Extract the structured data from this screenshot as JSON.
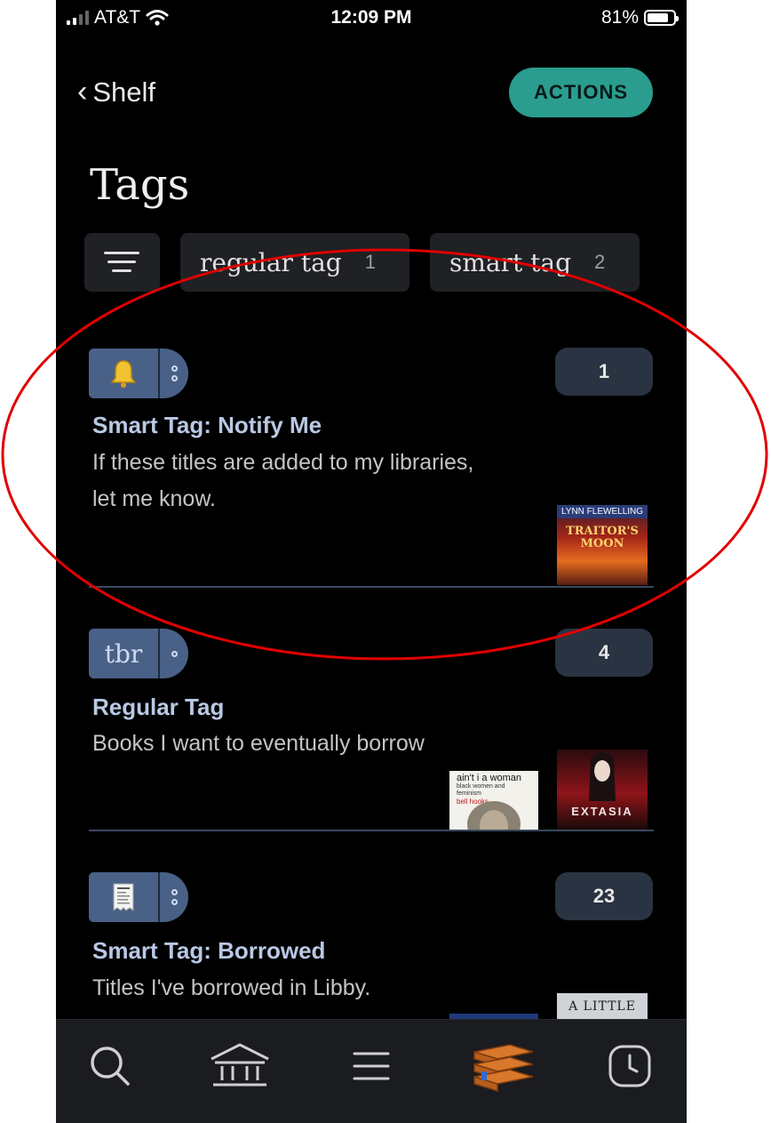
{
  "status_bar": {
    "carrier": "AT&T",
    "time": "12:09 PM",
    "battery_percent": "81%",
    "battery_level": 0.81
  },
  "nav": {
    "back_label": "Shelf",
    "actions_label": "ACTIONS"
  },
  "page_title": "Tags",
  "filters": [
    {
      "label": "regular tag",
      "count": "1"
    },
    {
      "label": "smart tag",
      "count": "2"
    }
  ],
  "tags": [
    {
      "badge_icon": "bell-icon",
      "badge_text": "",
      "title": "Smart Tag: Notify Me",
      "description": "If these titles are added to my libraries, let me know.",
      "count": "1",
      "covers": [
        {
          "name": "book-cover-traitors-moon",
          "author": "LYNN FLEWELLING",
          "title": "TRAITOR'S MOON"
        }
      ]
    },
    {
      "badge_icon": "",
      "badge_text": "tbr",
      "title": "Regular Tag",
      "description": "Books I want to eventually borrow",
      "count": "4",
      "covers": [
        {
          "name": "book-cover-aint-i-a-woman",
          "title": "ain't i a woman",
          "subtitle": "black women and feminism",
          "author": "bell hooks"
        },
        {
          "name": "book-cover-extasia",
          "title": "EXTASIA"
        }
      ]
    },
    {
      "badge_icon": "receipt-icon",
      "badge_text": "",
      "title": "Smart Tag: Borrowed",
      "description": "Titles I've borrowed in Libby.",
      "count": "23",
      "covers": [
        {
          "name": "book-cover-a-little-life",
          "title": "A LITTLE"
        }
      ]
    }
  ],
  "tabbar": [
    "search-icon",
    "library-icon",
    "menu-icon",
    "shelf-icon",
    "timeline-icon"
  ],
  "colors": {
    "accent": "#2a9d8f",
    "tag_badge": "#4a6187",
    "title_blue": "#b9c8e3",
    "active_tab": "#d9772b",
    "annotation": "#e10000"
  }
}
